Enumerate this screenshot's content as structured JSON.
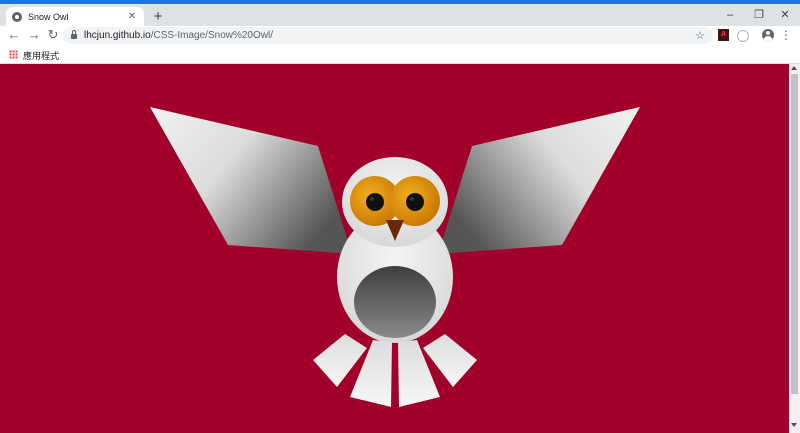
{
  "browser": {
    "tab_title": "Snow Owl",
    "tab_close": "✕",
    "new_tab": "+",
    "window_controls": {
      "minimize": "–",
      "maximize": "❐",
      "close": "✕"
    },
    "nav": {
      "back": "←",
      "forward": "→",
      "reload": "↻"
    },
    "url_host": "lhcjun.github.io",
    "url_path": "/CSS-Image/Snow%20Owl/",
    "star": "☆",
    "pdf_label": "A",
    "menu": "⋮",
    "bookmarks_bar": {
      "apps_label": "應用程式"
    }
  },
  "page": {
    "background_color": "#a0002a",
    "illustration": "snow-owl",
    "colors": {
      "wing_light": "#f2f2f2",
      "wing_dark": "#555555",
      "body": "#e6e6e6",
      "belly_dark": "#505050",
      "eye_ring": "#e0960f",
      "pupil": "#111111",
      "beak": "#6a2a08"
    }
  }
}
